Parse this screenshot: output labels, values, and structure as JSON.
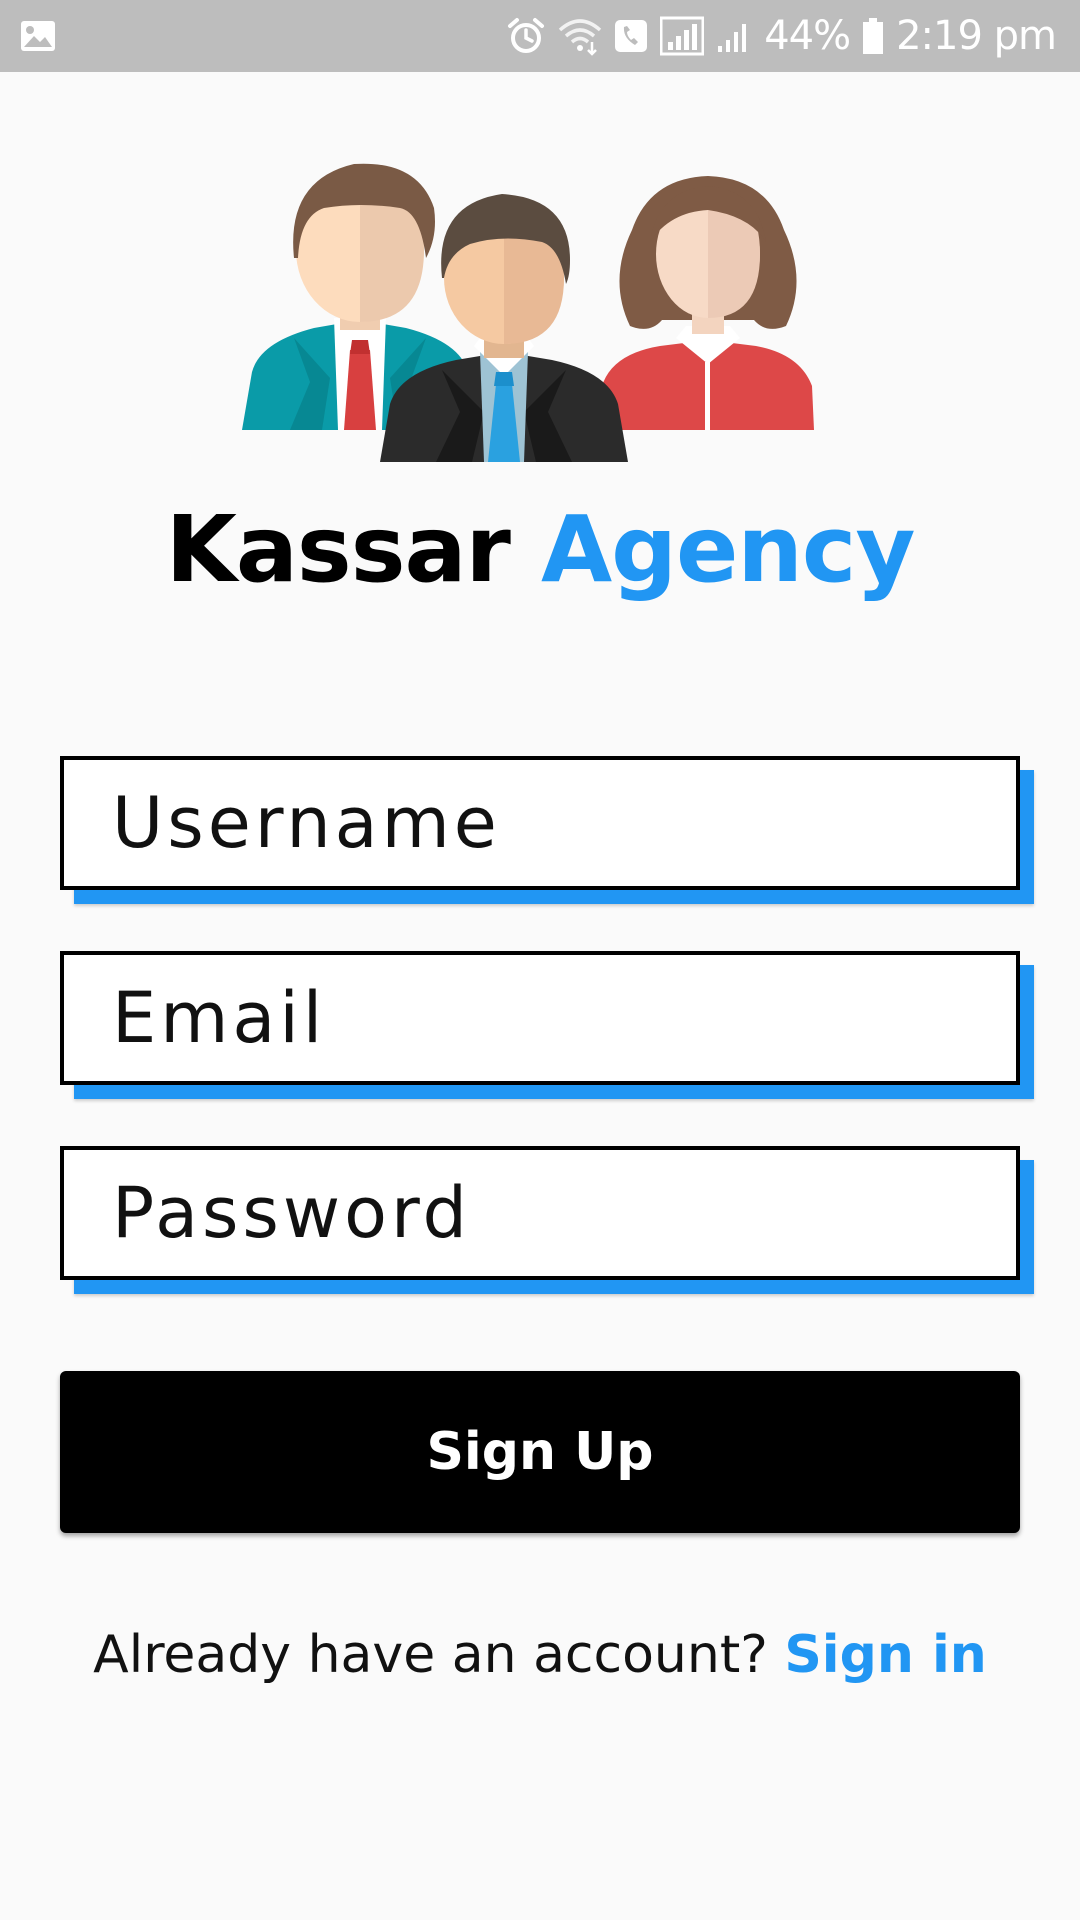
{
  "status_bar": {
    "battery": "44%",
    "time": "2:19 pm",
    "icons": [
      "image-icon",
      "alarm-icon",
      "wifi-icon",
      "call-icon",
      "signal-icon",
      "signal-icon",
      "battery-icon"
    ]
  },
  "brand": {
    "part1": "Kassar",
    "part2": "Agency",
    "accent_color": "#2196f3"
  },
  "form": {
    "username_placeholder": "Username",
    "email_placeholder": "Email",
    "password_placeholder": "Password",
    "username_value": "",
    "email_value": "",
    "password_value": ""
  },
  "signup_button": {
    "label": "Sign Up"
  },
  "footer": {
    "prompt": "Already have an account? ",
    "link": "Sign in"
  },
  "colors": {
    "accent": "#2196f3",
    "background": "#fafafa",
    "status_bar": "#bdbdbd",
    "button": "#000000"
  }
}
